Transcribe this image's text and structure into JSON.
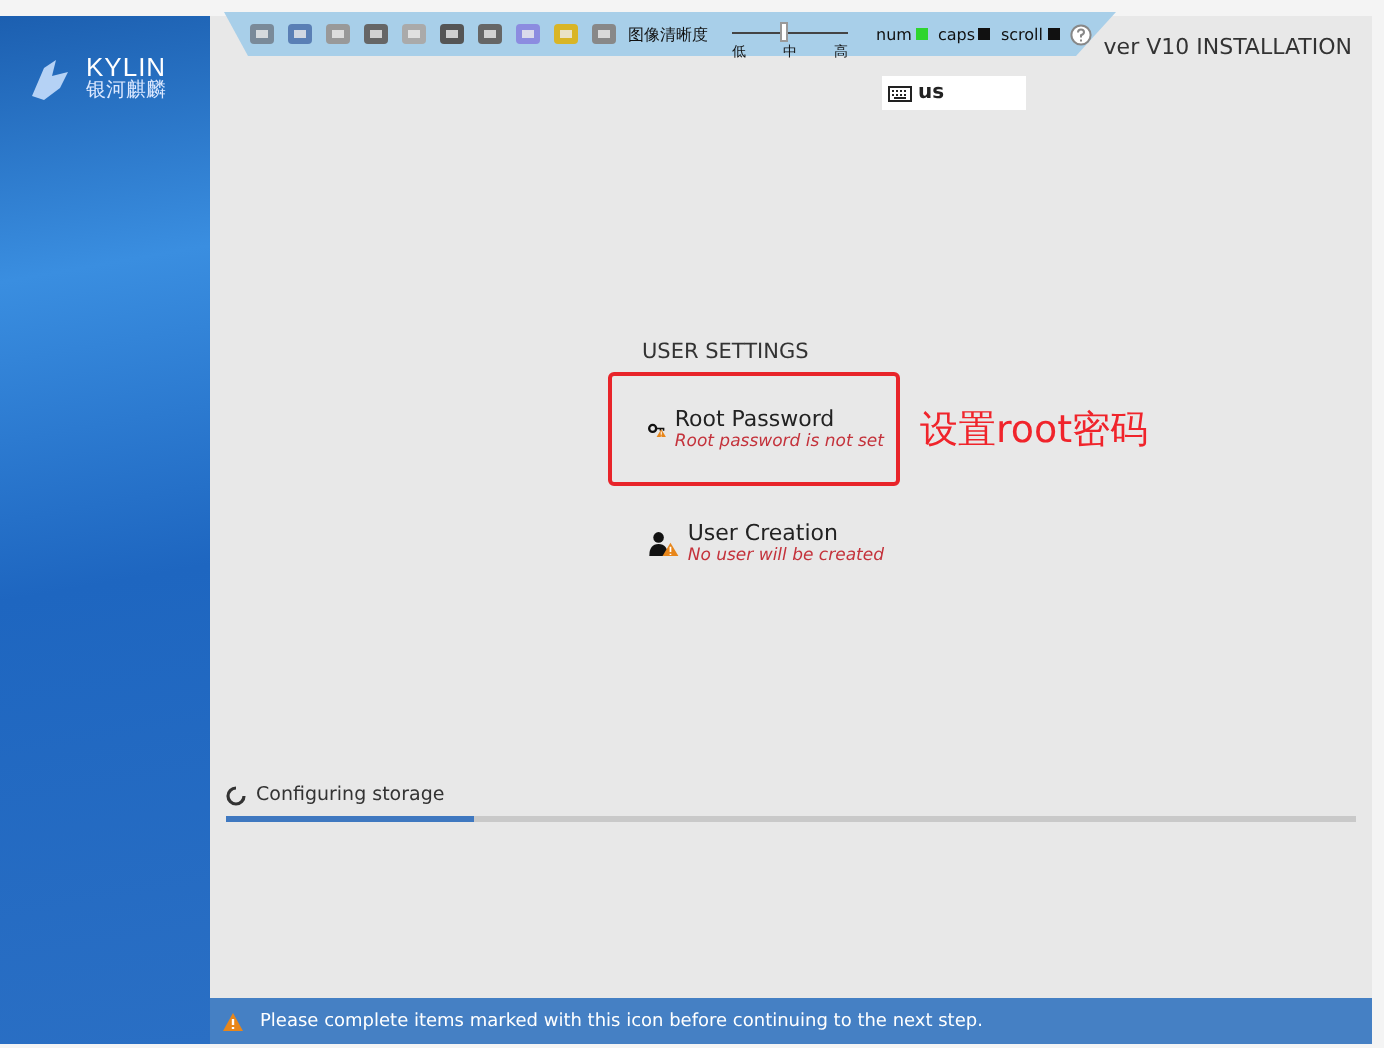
{
  "sidebar": {
    "logo_text": "KYLIN",
    "logo_subtitle": "银河麒麟"
  },
  "header": {
    "title": "ver V10 INSTALLATION",
    "keyboard_layout": "us"
  },
  "remote_toolbar": {
    "quality_label": "图像清晰度",
    "quality": {
      "level": 0.45,
      "ticks": [
        "低",
        "中",
        "高"
      ]
    },
    "indicators": [
      {
        "label": "num",
        "on": true
      },
      {
        "label": "caps",
        "on": false
      },
      {
        "label": "scroll",
        "on": false
      }
    ]
  },
  "section": {
    "title": "USER SETTINGS",
    "spokes": [
      {
        "kind": "key",
        "title": "Root Password",
        "status": "Root password is not set",
        "highlighted": true
      },
      {
        "kind": "user",
        "title": "User Creation",
        "status": "No user will be created",
        "highlighted": false
      }
    ]
  },
  "annotation": "设置root密码",
  "progress": {
    "label": "Configuring storage",
    "level": 0.22
  },
  "status_bar": {
    "message": "Please complete items marked with this icon before continuing to the next step."
  }
}
